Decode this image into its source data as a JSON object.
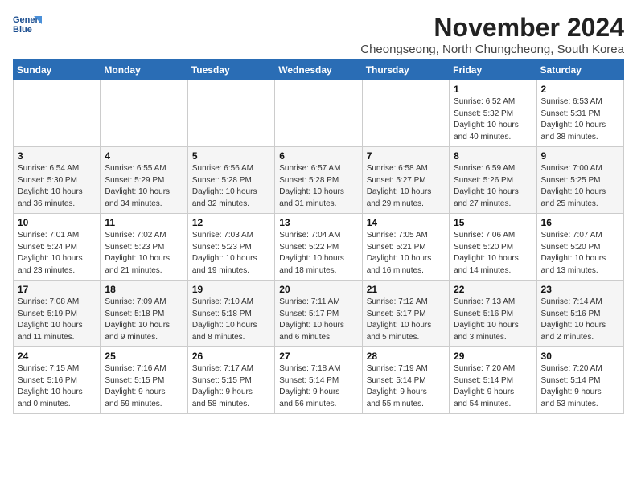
{
  "header": {
    "logo_line1": "General",
    "logo_line2": "Blue",
    "month_title": "November 2024",
    "location": "Cheongseong, North Chungcheong, South Korea"
  },
  "weekdays": [
    "Sunday",
    "Monday",
    "Tuesday",
    "Wednesday",
    "Thursday",
    "Friday",
    "Saturday"
  ],
  "weeks": [
    [
      {
        "day": "",
        "info": ""
      },
      {
        "day": "",
        "info": ""
      },
      {
        "day": "",
        "info": ""
      },
      {
        "day": "",
        "info": ""
      },
      {
        "day": "",
        "info": ""
      },
      {
        "day": "1",
        "info": "Sunrise: 6:52 AM\nSunset: 5:32 PM\nDaylight: 10 hours\nand 40 minutes."
      },
      {
        "day": "2",
        "info": "Sunrise: 6:53 AM\nSunset: 5:31 PM\nDaylight: 10 hours\nand 38 minutes."
      }
    ],
    [
      {
        "day": "3",
        "info": "Sunrise: 6:54 AM\nSunset: 5:30 PM\nDaylight: 10 hours\nand 36 minutes."
      },
      {
        "day": "4",
        "info": "Sunrise: 6:55 AM\nSunset: 5:29 PM\nDaylight: 10 hours\nand 34 minutes."
      },
      {
        "day": "5",
        "info": "Sunrise: 6:56 AM\nSunset: 5:28 PM\nDaylight: 10 hours\nand 32 minutes."
      },
      {
        "day": "6",
        "info": "Sunrise: 6:57 AM\nSunset: 5:28 PM\nDaylight: 10 hours\nand 31 minutes."
      },
      {
        "day": "7",
        "info": "Sunrise: 6:58 AM\nSunset: 5:27 PM\nDaylight: 10 hours\nand 29 minutes."
      },
      {
        "day": "8",
        "info": "Sunrise: 6:59 AM\nSunset: 5:26 PM\nDaylight: 10 hours\nand 27 minutes."
      },
      {
        "day": "9",
        "info": "Sunrise: 7:00 AM\nSunset: 5:25 PM\nDaylight: 10 hours\nand 25 minutes."
      }
    ],
    [
      {
        "day": "10",
        "info": "Sunrise: 7:01 AM\nSunset: 5:24 PM\nDaylight: 10 hours\nand 23 minutes."
      },
      {
        "day": "11",
        "info": "Sunrise: 7:02 AM\nSunset: 5:23 PM\nDaylight: 10 hours\nand 21 minutes."
      },
      {
        "day": "12",
        "info": "Sunrise: 7:03 AM\nSunset: 5:23 PM\nDaylight: 10 hours\nand 19 minutes."
      },
      {
        "day": "13",
        "info": "Sunrise: 7:04 AM\nSunset: 5:22 PM\nDaylight: 10 hours\nand 18 minutes."
      },
      {
        "day": "14",
        "info": "Sunrise: 7:05 AM\nSunset: 5:21 PM\nDaylight: 10 hours\nand 16 minutes."
      },
      {
        "day": "15",
        "info": "Sunrise: 7:06 AM\nSunset: 5:20 PM\nDaylight: 10 hours\nand 14 minutes."
      },
      {
        "day": "16",
        "info": "Sunrise: 7:07 AM\nSunset: 5:20 PM\nDaylight: 10 hours\nand 13 minutes."
      }
    ],
    [
      {
        "day": "17",
        "info": "Sunrise: 7:08 AM\nSunset: 5:19 PM\nDaylight: 10 hours\nand 11 minutes."
      },
      {
        "day": "18",
        "info": "Sunrise: 7:09 AM\nSunset: 5:18 PM\nDaylight: 10 hours\nand 9 minutes."
      },
      {
        "day": "19",
        "info": "Sunrise: 7:10 AM\nSunset: 5:18 PM\nDaylight: 10 hours\nand 8 minutes."
      },
      {
        "day": "20",
        "info": "Sunrise: 7:11 AM\nSunset: 5:17 PM\nDaylight: 10 hours\nand 6 minutes."
      },
      {
        "day": "21",
        "info": "Sunrise: 7:12 AM\nSunset: 5:17 PM\nDaylight: 10 hours\nand 5 minutes."
      },
      {
        "day": "22",
        "info": "Sunrise: 7:13 AM\nSunset: 5:16 PM\nDaylight: 10 hours\nand 3 minutes."
      },
      {
        "day": "23",
        "info": "Sunrise: 7:14 AM\nSunset: 5:16 PM\nDaylight: 10 hours\nand 2 minutes."
      }
    ],
    [
      {
        "day": "24",
        "info": "Sunrise: 7:15 AM\nSunset: 5:16 PM\nDaylight: 10 hours\nand 0 minutes."
      },
      {
        "day": "25",
        "info": "Sunrise: 7:16 AM\nSunset: 5:15 PM\nDaylight: 9 hours\nand 59 minutes."
      },
      {
        "day": "26",
        "info": "Sunrise: 7:17 AM\nSunset: 5:15 PM\nDaylight: 9 hours\nand 58 minutes."
      },
      {
        "day": "27",
        "info": "Sunrise: 7:18 AM\nSunset: 5:14 PM\nDaylight: 9 hours\nand 56 minutes."
      },
      {
        "day": "28",
        "info": "Sunrise: 7:19 AM\nSunset: 5:14 PM\nDaylight: 9 hours\nand 55 minutes."
      },
      {
        "day": "29",
        "info": "Sunrise: 7:20 AM\nSunset: 5:14 PM\nDaylight: 9 hours\nand 54 minutes."
      },
      {
        "day": "30",
        "info": "Sunrise: 7:20 AM\nSunset: 5:14 PM\nDaylight: 9 hours\nand 53 minutes."
      }
    ]
  ]
}
